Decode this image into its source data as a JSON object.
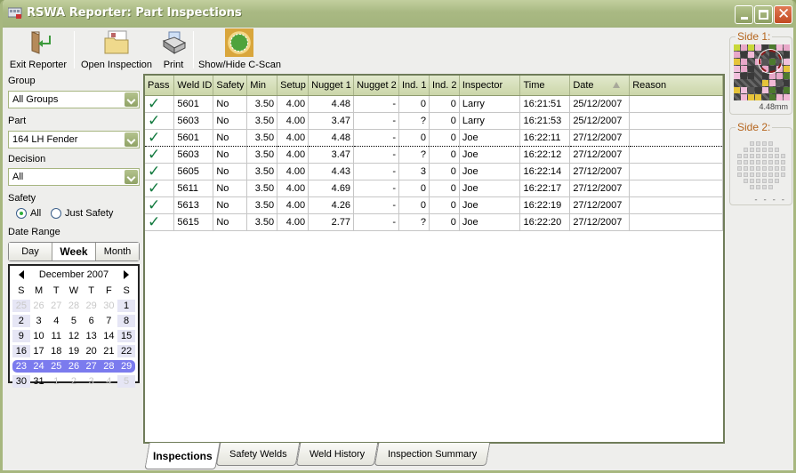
{
  "window": {
    "title": "RSWA Reporter: Part Inspections",
    "controls": {
      "minimize": "minimize-icon",
      "maximize": "maximize-icon",
      "close": "close-icon"
    }
  },
  "toolbar": {
    "exit_label": "Exit Reporter",
    "open_label": "Open Inspection",
    "print_label": "Print",
    "cscan_label": "Show/Hide C-Scan"
  },
  "filters": {
    "group_label": "Group",
    "group_value": "All Groups",
    "part_label": "Part",
    "part_value": "164 LH Fender",
    "decision_label": "Decision",
    "decision_value": "All",
    "safety_label": "Safety",
    "safety_options": [
      {
        "label": "All",
        "selected": true
      },
      {
        "label": "Just Safety",
        "selected": false
      }
    ],
    "date_range_label": "Date Range",
    "date_range_options": [
      "Day",
      "Week",
      "Month"
    ],
    "date_range_selected": "Week"
  },
  "calendar": {
    "month_label": "December 2007",
    "weekdays": [
      "S",
      "M",
      "T",
      "W",
      "T",
      "F",
      "S"
    ],
    "weeks": [
      [
        "25",
        "26",
        "27",
        "28",
        "29",
        "30",
        "1"
      ],
      [
        "2",
        "3",
        "4",
        "5",
        "6",
        "7",
        "8"
      ],
      [
        "9",
        "10",
        "11",
        "12",
        "13",
        "14",
        "15"
      ],
      [
        "16",
        "17",
        "18",
        "19",
        "20",
        "21",
        "22"
      ],
      [
        "23",
        "24",
        "25",
        "26",
        "27",
        "28",
        "29"
      ],
      [
        "30",
        "31",
        "1",
        "2",
        "3",
        "4",
        "5"
      ]
    ],
    "selected_week_index": 4
  },
  "table": {
    "columns": [
      "Pass",
      "Weld ID",
      "Safety",
      "Min",
      "Setup",
      "Nugget 1",
      "Nugget 2",
      "Ind. 1",
      "Ind. 2",
      "Inspector",
      "Time",
      "Date",
      "Reason"
    ],
    "sorted_column": "Date",
    "rows": [
      {
        "pass": "✓",
        "weld_id": "5601",
        "safety": "No",
        "min": "3.50",
        "setup": "4.00",
        "nugget1": "4.48",
        "nugget2": "-",
        "ind1": "0",
        "ind2": "0",
        "inspector": "Larry",
        "time": "16:21:51",
        "date": "25/12/2007",
        "reason": ""
      },
      {
        "pass": "✓",
        "weld_id": "5603",
        "safety": "No",
        "min": "3.50",
        "setup": "4.00",
        "nugget1": "3.47",
        "nugget2": "-",
        "ind1": "?",
        "ind2": "0",
        "inspector": "Larry",
        "time": "16:21:53",
        "date": "25/12/2007",
        "reason": ""
      },
      {
        "pass": "✓",
        "weld_id": "5601",
        "safety": "No",
        "min": "3.50",
        "setup": "4.00",
        "nugget1": "4.48",
        "nugget2": "-",
        "ind1": "0",
        "ind2": "0",
        "inspector": "Joe",
        "time": "16:22:11",
        "date": "27/12/2007",
        "reason": ""
      },
      {
        "pass": "✓",
        "weld_id": "5603",
        "safety": "No",
        "min": "3.50",
        "setup": "4.00",
        "nugget1": "3.47",
        "nugget2": "-",
        "ind1": "?",
        "ind2": "0",
        "inspector": "Joe",
        "time": "16:22:12",
        "date": "27/12/2007",
        "reason": ""
      },
      {
        "pass": "✓",
        "weld_id": "5605",
        "safety": "No",
        "min": "3.50",
        "setup": "4.00",
        "nugget1": "4.43",
        "nugget2": "-",
        "ind1": "3",
        "ind2": "0",
        "inspector": "Joe",
        "time": "16:22:14",
        "date": "27/12/2007",
        "reason": ""
      },
      {
        "pass": "✓",
        "weld_id": "5611",
        "safety": "No",
        "min": "3.50",
        "setup": "4.00",
        "nugget1": "4.69",
        "nugget2": "-",
        "ind1": "0",
        "ind2": "0",
        "inspector": "Joe",
        "time": "16:22:17",
        "date": "27/12/2007",
        "reason": ""
      },
      {
        "pass": "✓",
        "weld_id": "5613",
        "safety": "No",
        "min": "3.50",
        "setup": "4.00",
        "nugget1": "4.26",
        "nugget2": "-",
        "ind1": "0",
        "ind2": "0",
        "inspector": "Joe",
        "time": "16:22:19",
        "date": "27/12/2007",
        "reason": ""
      },
      {
        "pass": "✓",
        "weld_id": "5615",
        "safety": "No",
        "min": "3.50",
        "setup": "4.00",
        "nugget1": "2.77",
        "nugget2": "-",
        "ind1": "?",
        "ind2": "0",
        "inspector": "Joe",
        "time": "16:22:20",
        "date": "27/12/2007",
        "reason": ""
      }
    ],
    "focused_row_index": 2
  },
  "tabs": [
    {
      "label": "Inspections",
      "active": true
    },
    {
      "label": "Safety Welds",
      "active": false
    },
    {
      "label": "Weld History",
      "active": false
    },
    {
      "label": "Inspection Summary",
      "active": false
    }
  ],
  "cscan": {
    "side1_label": "Side 1:",
    "side1_value": "4.48mm",
    "side2_label": "Side 2:",
    "side2_value": "- - - -"
  },
  "colors": {
    "title_bar": "#a9b983",
    "header_row": "#cbd6a9",
    "check_mark": "#137a3f",
    "selected_week": "#7b7bee",
    "side_label": "#b5651d"
  }
}
